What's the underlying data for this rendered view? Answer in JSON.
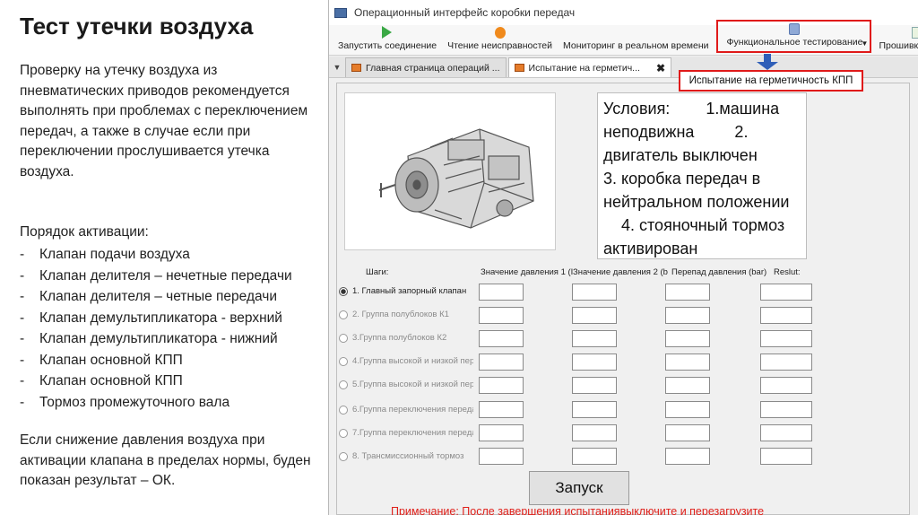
{
  "slide": {
    "title": "Тест утечки воздуха",
    "intro": "Проверку на утечку воздуха из пневматических приводов рекомендуется выполнять при проблемах с переключением передач, а также в случае  если при переключении прослушивается утечка воздуха.",
    "order_heading": "Порядок активации:",
    "order_items": [
      "Клапан подачи воздуха",
      "Клапан делителя – нечетные передачи",
      "Клапан делителя – четные передачи",
      "Клапан демультипликатора - верхний",
      "Клапан демультипликатора - нижний",
      "Клапан основной КПП",
      "Клапан основной КПП",
      "Тормоз промежуточного вала"
    ],
    "bullet": "-",
    "outro": "Если снижение давления воздуха при активации клапана в пределах нормы, буден показан результат – ОК."
  },
  "window": {
    "title": "Операционный интерфейс коробки передач",
    "toolbar": [
      {
        "label": "Запустить соединение",
        "icon": "play-icon"
      },
      {
        "label": "Чтение неисправностей",
        "icon": "fault-read-icon"
      },
      {
        "label": "Мониторинг в реальном времени",
        "icon": "monitor-icon"
      },
      {
        "label": "Функциональное тестирование",
        "icon": "functional-test-icon"
      },
      {
        "label": "Прошивка файла",
        "icon": "file-flash-icon"
      }
    ],
    "tabs": [
      {
        "label": "Главная страница операций ...",
        "active": false
      },
      {
        "label": "Испытание на герметич...",
        "active": true
      }
    ],
    "tab_close": "✖",
    "callout": "Испытание на герметичность КПП",
    "conditions": [
      "Условия:        1.машина",
      "неподвижна         2.",
      "двигатель выключен",
      "3. коробка передач в",
      "нейтральном положении",
      "    4. стояночный тормоз",
      "активирован"
    ],
    "columns": {
      "steps": "Шаги:",
      "p1": "Значение давления 1 (I",
      "p2": "Значение давления 2 (b",
      "diff": "Перепад давления (bar)",
      "result": "Reslut:"
    },
    "steps": [
      {
        "label": "1. Главный запорный клапан",
        "selected": true
      },
      {
        "label": "2. Группа полублоков К1",
        "selected": false
      },
      {
        "label": "3.Группа полублоков К2",
        "selected": false
      },
      {
        "label": "4.Группа высокой и низкой пере",
        "selected": false
      },
      {
        "label": "5.Группа высокой и низкой пере",
        "selected": false
      },
      {
        "label": "6.Группа переключения переда",
        "selected": false
      },
      {
        "label": "7.Группа переключения переда",
        "selected": false
      },
      {
        "label": "8. Трансмиссионный тормоз",
        "selected": false
      }
    ],
    "launch_label": "Запуск",
    "note": "Примечание: После завершения испытаниявыключите и перезагрузите"
  },
  "colors": {
    "highlight": "#e01a1a",
    "arrow": "#2f5fb8",
    "note": "#e0201a"
  }
}
